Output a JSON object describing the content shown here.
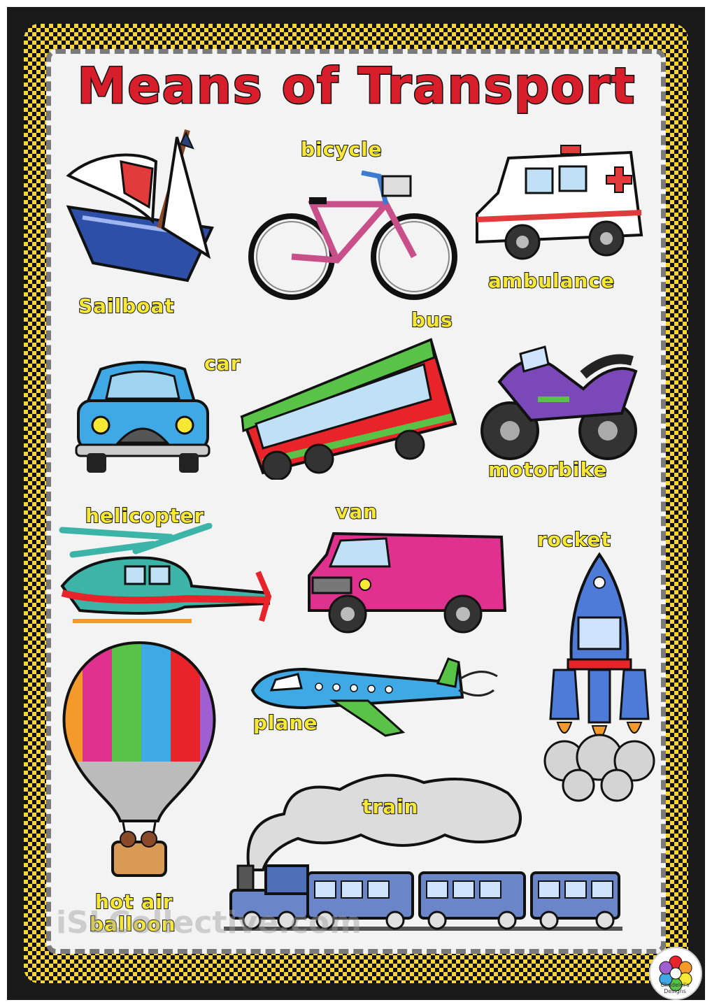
{
  "title": "Means of Transport",
  "labels": {
    "sailboat": "Sailboat",
    "bicycle": "bicycle",
    "ambulance": "ambulance",
    "bus": "bus",
    "car": "car",
    "motorbike": "motorbike",
    "helicopter": "helicopter",
    "van": "van",
    "rocket": "rocket",
    "plane": "plane",
    "train": "train",
    "hot_air_balloon_line1": "hot air",
    "hot_air_balloon_line2": "balloon"
  },
  "watermark": "iSLCollective.com",
  "brand": "Chadelel's Designs",
  "colors": {
    "title_red": "#d81e2a",
    "label_yellow": "#f7e836",
    "border_yellow": "#f6d43a",
    "border_black": "#111111"
  }
}
